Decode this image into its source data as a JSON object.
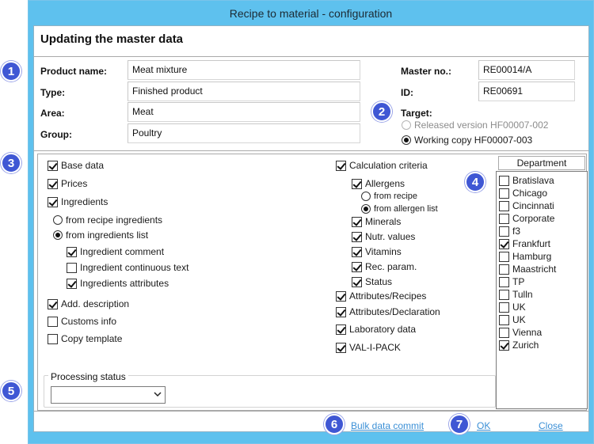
{
  "window": {
    "title": "Recipe to material - configuration"
  },
  "heading": "Updating the master data",
  "fields": {
    "product_name": {
      "label": "Product name:",
      "value": "Meat mixture"
    },
    "type": {
      "label": "Type:",
      "value": "Finished product"
    },
    "area": {
      "label": "Area:",
      "value": "Meat"
    },
    "group": {
      "label": "Group:",
      "value": "Poultry"
    },
    "master_no": {
      "label": "Master no.:",
      "value": "RE00014/A"
    },
    "id": {
      "label": "ID:",
      "value": "RE00691"
    }
  },
  "target": {
    "label": "Target:",
    "options": [
      {
        "label": "Released version HF00007-002",
        "selected": false,
        "enabled": false
      },
      {
        "label": "Working copy HF00007-003",
        "selected": true,
        "enabled": true
      }
    ]
  },
  "left_options": {
    "base_data": {
      "label": "Base data",
      "checked": true
    },
    "prices": {
      "label": "Prices",
      "checked": true
    },
    "ingredients": {
      "label": "Ingredients",
      "checked": true
    },
    "from_recipe_ingredients": {
      "label": "from recipe ingredients",
      "selected": false
    },
    "from_ingredients_list": {
      "label": "from ingredients list",
      "selected": true
    },
    "ingredient_comment": {
      "label": "Ingredient comment",
      "checked": true
    },
    "ingredient_continuous_text": {
      "label": "Ingredient continuous text",
      "checked": false
    },
    "ingredients_attributes": {
      "label": "Ingredients attributes",
      "checked": true
    },
    "add_description": {
      "label": "Add. description",
      "checked": true
    },
    "customs_info": {
      "label": "Customs info",
      "checked": false
    },
    "copy_template": {
      "label": "Copy template",
      "checked": false
    }
  },
  "right_options": {
    "calculation_criteria": {
      "label": "Calculation criteria",
      "checked": true
    },
    "allergens": {
      "label": "Allergens",
      "checked": true
    },
    "from_recipe": {
      "label": "from recipe",
      "selected": false
    },
    "from_allergen_list": {
      "label": "from allergen list",
      "selected": true
    },
    "minerals": {
      "label": "Minerals",
      "checked": true
    },
    "nutr_values": {
      "label": "Nutr. values",
      "checked": true
    },
    "vitamins": {
      "label": "Vitamins",
      "checked": true
    },
    "rec_param": {
      "label": "Rec. param.",
      "checked": true
    },
    "status": {
      "label": "Status",
      "checked": true
    },
    "attributes_recipes": {
      "label": "Attributes/Recipes",
      "checked": true
    },
    "attributes_declaration": {
      "label": "Attributes/Declaration",
      "checked": true
    },
    "laboratory_data": {
      "label": "Laboratory data",
      "checked": true
    },
    "val_i_pack": {
      "label": "VAL-I-PACK",
      "checked": true
    }
  },
  "department": {
    "header": "Department",
    "items": [
      {
        "label": "Bratislava",
        "checked": false
      },
      {
        "label": "Chicago",
        "checked": false
      },
      {
        "label": "Cincinnati",
        "checked": false
      },
      {
        "label": "Corporate",
        "checked": false
      },
      {
        "label": "f3",
        "checked": false
      },
      {
        "label": "Frankfurt",
        "checked": true
      },
      {
        "label": "Hamburg",
        "checked": false
      },
      {
        "label": "Maastricht",
        "checked": false
      },
      {
        "label": "TP",
        "checked": false
      },
      {
        "label": "Tulln",
        "checked": false
      },
      {
        "label": "UK",
        "checked": false
      },
      {
        "label": "UK",
        "checked": false
      },
      {
        "label": "Vienna",
        "checked": false
      },
      {
        "label": "Zurich",
        "checked": true
      }
    ]
  },
  "processing_status": {
    "label": "Processing status",
    "value": ""
  },
  "footer": {
    "bulk_data_commit": "Bulk data commit",
    "ok": "OK",
    "close": "Close"
  },
  "badges": [
    "1",
    "2",
    "3",
    "4",
    "5",
    "6",
    "7"
  ],
  "colors": {
    "titlebar": "#5ec1ee",
    "badge": "#3f57d4",
    "link": "#3a8fd6"
  }
}
